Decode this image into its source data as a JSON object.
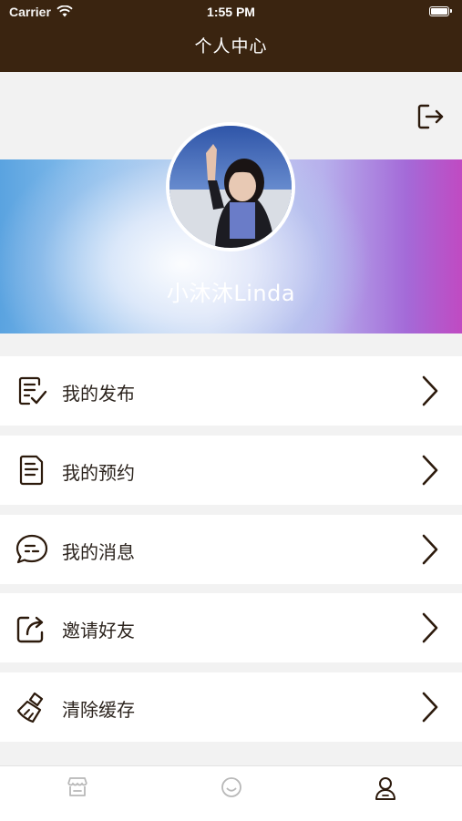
{
  "status_bar": {
    "carrier": "Carrier",
    "time": "1:55 PM"
  },
  "nav": {
    "title": "个人中心"
  },
  "profile": {
    "username": "小沐沐Linda"
  },
  "menu": [
    {
      "label": "我的发布",
      "icon": "edit-list-icon"
    },
    {
      "label": "我的预约",
      "icon": "document-icon"
    },
    {
      "label": "我的消息",
      "icon": "message-bubble-icon"
    },
    {
      "label": "邀请好友",
      "icon": "share-icon"
    },
    {
      "label": "清除缓存",
      "icon": "broom-icon"
    }
  ],
  "tabbar": [
    {
      "icon": "store-icon",
      "active": false
    },
    {
      "icon": "smile-icon",
      "active": false
    },
    {
      "icon": "person-icon",
      "active": true
    }
  ],
  "colors": {
    "nav_bg": "#3a2410",
    "icon_dark": "#2c1a0c",
    "tab_inactive": "#b8b8b8"
  }
}
